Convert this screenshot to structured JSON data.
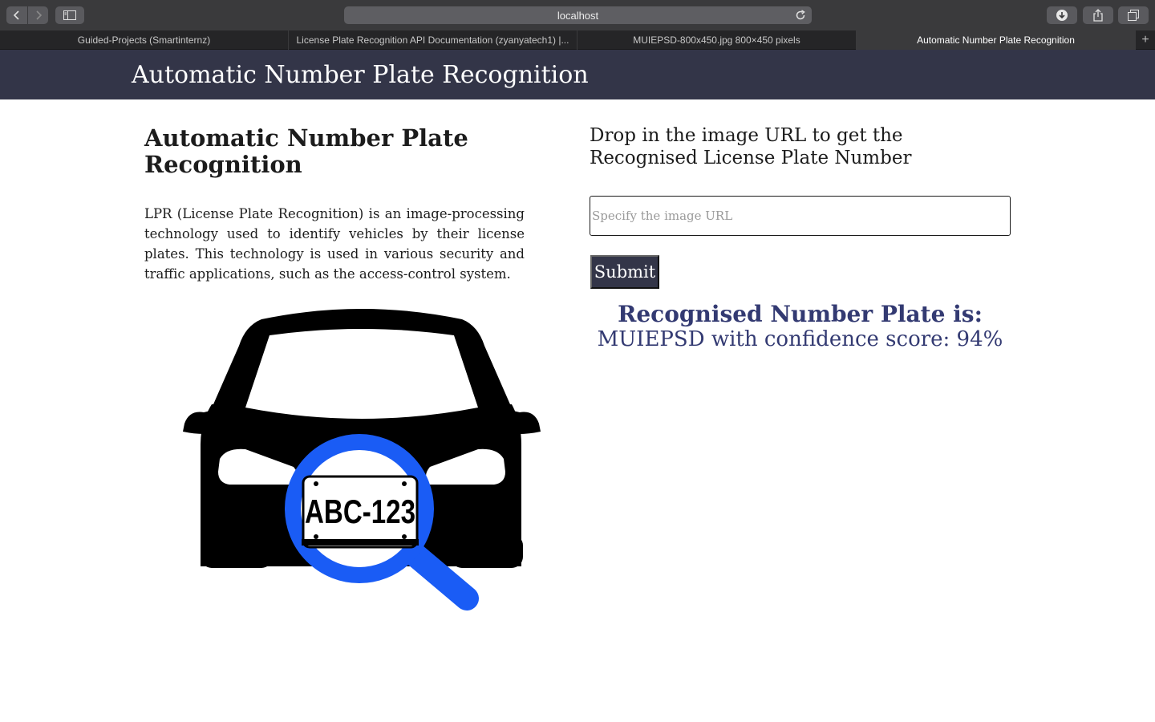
{
  "browser": {
    "address": "localhost",
    "tabs": [
      {
        "label": "Guided-Projects (Smartinternz)"
      },
      {
        "label": "License Plate Recognition API Documentation (zyanyatech1) |..."
      },
      {
        "label": "MUIEPSD-800x450.jpg 800×450 pixels"
      },
      {
        "label": "Automatic Number Plate Recognition"
      }
    ],
    "new_tab_glyph": "+"
  },
  "header": {
    "title": "Automatic Number Plate Recognition"
  },
  "left": {
    "title": "Automatic Number Plate Recognition",
    "description": "LPR (License Plate Recognition) is an image-processing technology used to identify vehicles by their license plates. This technology is used in various security and traffic applications, such as the access-control system.",
    "illustration": {
      "plate_text": "ABC-123",
      "car_color": "#000000",
      "magnifier_color": "#1a5cf5"
    }
  },
  "right": {
    "prompt": "Drop in the image URL to get the Recognised License Plate Number",
    "url_input": {
      "value": "",
      "placeholder": "Specify the image URL"
    },
    "submit_label": "Submit",
    "result_title": "Recognised Number Plate is:",
    "result_text": "MUIEPSD with confidence score: 94%"
  },
  "colors": {
    "header_bg": "#333548",
    "accent_text": "#333a72"
  }
}
